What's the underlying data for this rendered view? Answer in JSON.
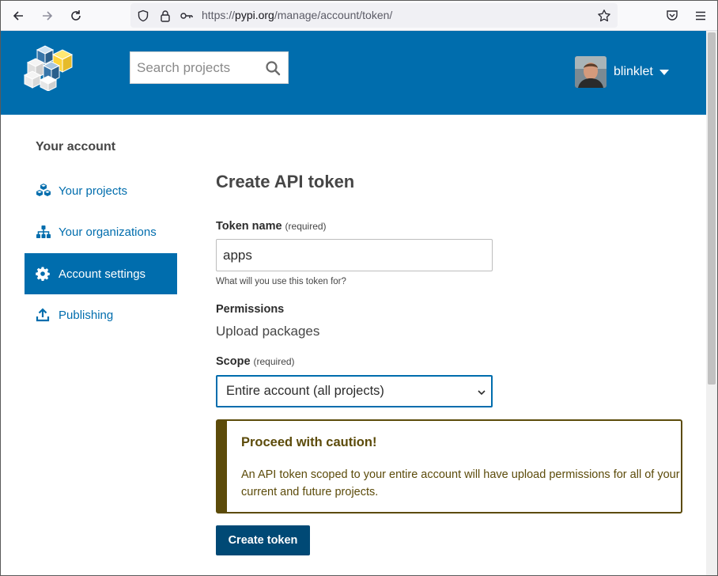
{
  "browser": {
    "url_scheme": "https://",
    "url_host": "pypi.org",
    "url_path": "/manage/account/token/"
  },
  "header": {
    "search": {
      "placeholder": "Search projects"
    },
    "user": {
      "username": "blinklet"
    },
    "brand_color": "#006dad"
  },
  "sidebar": {
    "title": "Your account",
    "items": [
      {
        "label": "Your projects",
        "icon": "cubes-icon",
        "active": false
      },
      {
        "label": "Your organizations",
        "icon": "sitemap-icon",
        "active": false
      },
      {
        "label": "Account settings",
        "icon": "gear-icon",
        "active": true
      },
      {
        "label": "Publishing",
        "icon": "upload-icon",
        "active": false
      }
    ]
  },
  "main": {
    "title": "Create API token",
    "token_name": {
      "label": "Token name",
      "required": "(required)",
      "value": "apps",
      "help": "What will you use this token for?"
    },
    "permissions": {
      "label": "Permissions",
      "value": "Upload packages"
    },
    "scope": {
      "label": "Scope",
      "required": "(required)",
      "selected": "Entire account (all projects)"
    },
    "caution": {
      "title": "Proceed with caution!",
      "text": "An API token scoped to your entire account will have upload permissions for all of your current and future projects.",
      "color": "#5c4b0a"
    },
    "submit_label": "Create token"
  }
}
